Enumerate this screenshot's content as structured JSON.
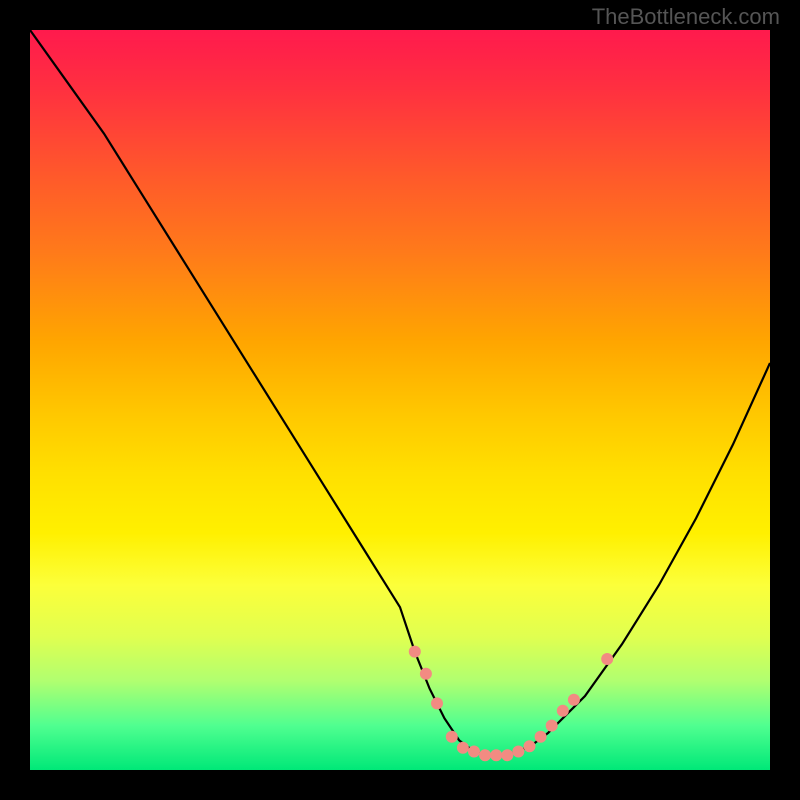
{
  "watermark": "TheBottleneck.com",
  "chart_data": {
    "type": "line",
    "title": "",
    "xlabel": "",
    "ylabel": "",
    "xlim": [
      0,
      100
    ],
    "ylim": [
      0,
      100
    ],
    "grid": false,
    "legend": false,
    "series": [
      {
        "name": "curve",
        "color": "#000000",
        "x": [
          0,
          5,
          10,
          15,
          20,
          25,
          30,
          35,
          40,
          45,
          50,
          52,
          54,
          56,
          58,
          60,
          62,
          64,
          66,
          68,
          70,
          75,
          80,
          85,
          90,
          95,
          100
        ],
        "y": [
          100,
          93,
          86,
          78,
          70,
          62,
          54,
          46,
          38,
          30,
          22,
          16,
          11,
          7,
          4,
          2.5,
          2,
          2,
          2.5,
          3.5,
          5,
          10,
          17,
          25,
          34,
          44,
          55
        ]
      }
    ],
    "markers": {
      "name": "dots",
      "color": "#f28b82",
      "radius": 6,
      "points": [
        {
          "x": 52,
          "y": 16
        },
        {
          "x": 53.5,
          "y": 13
        },
        {
          "x": 55,
          "y": 9
        },
        {
          "x": 57,
          "y": 4.5
        },
        {
          "x": 58.5,
          "y": 3
        },
        {
          "x": 60,
          "y": 2.5
        },
        {
          "x": 61.5,
          "y": 2
        },
        {
          "x": 63,
          "y": 2
        },
        {
          "x": 64.5,
          "y": 2
        },
        {
          "x": 66,
          "y": 2.5
        },
        {
          "x": 67.5,
          "y": 3.2
        },
        {
          "x": 69,
          "y": 4.5
        },
        {
          "x": 70.5,
          "y": 6
        },
        {
          "x": 72,
          "y": 8
        },
        {
          "x": 73.5,
          "y": 9.5
        },
        {
          "x": 78,
          "y": 15
        }
      ]
    },
    "gradient_stops": [
      {
        "pos": 0,
        "color": "#ff1a4d"
      },
      {
        "pos": 50,
        "color": "#ffc800"
      },
      {
        "pos": 100,
        "color": "#00e878"
      }
    ]
  }
}
